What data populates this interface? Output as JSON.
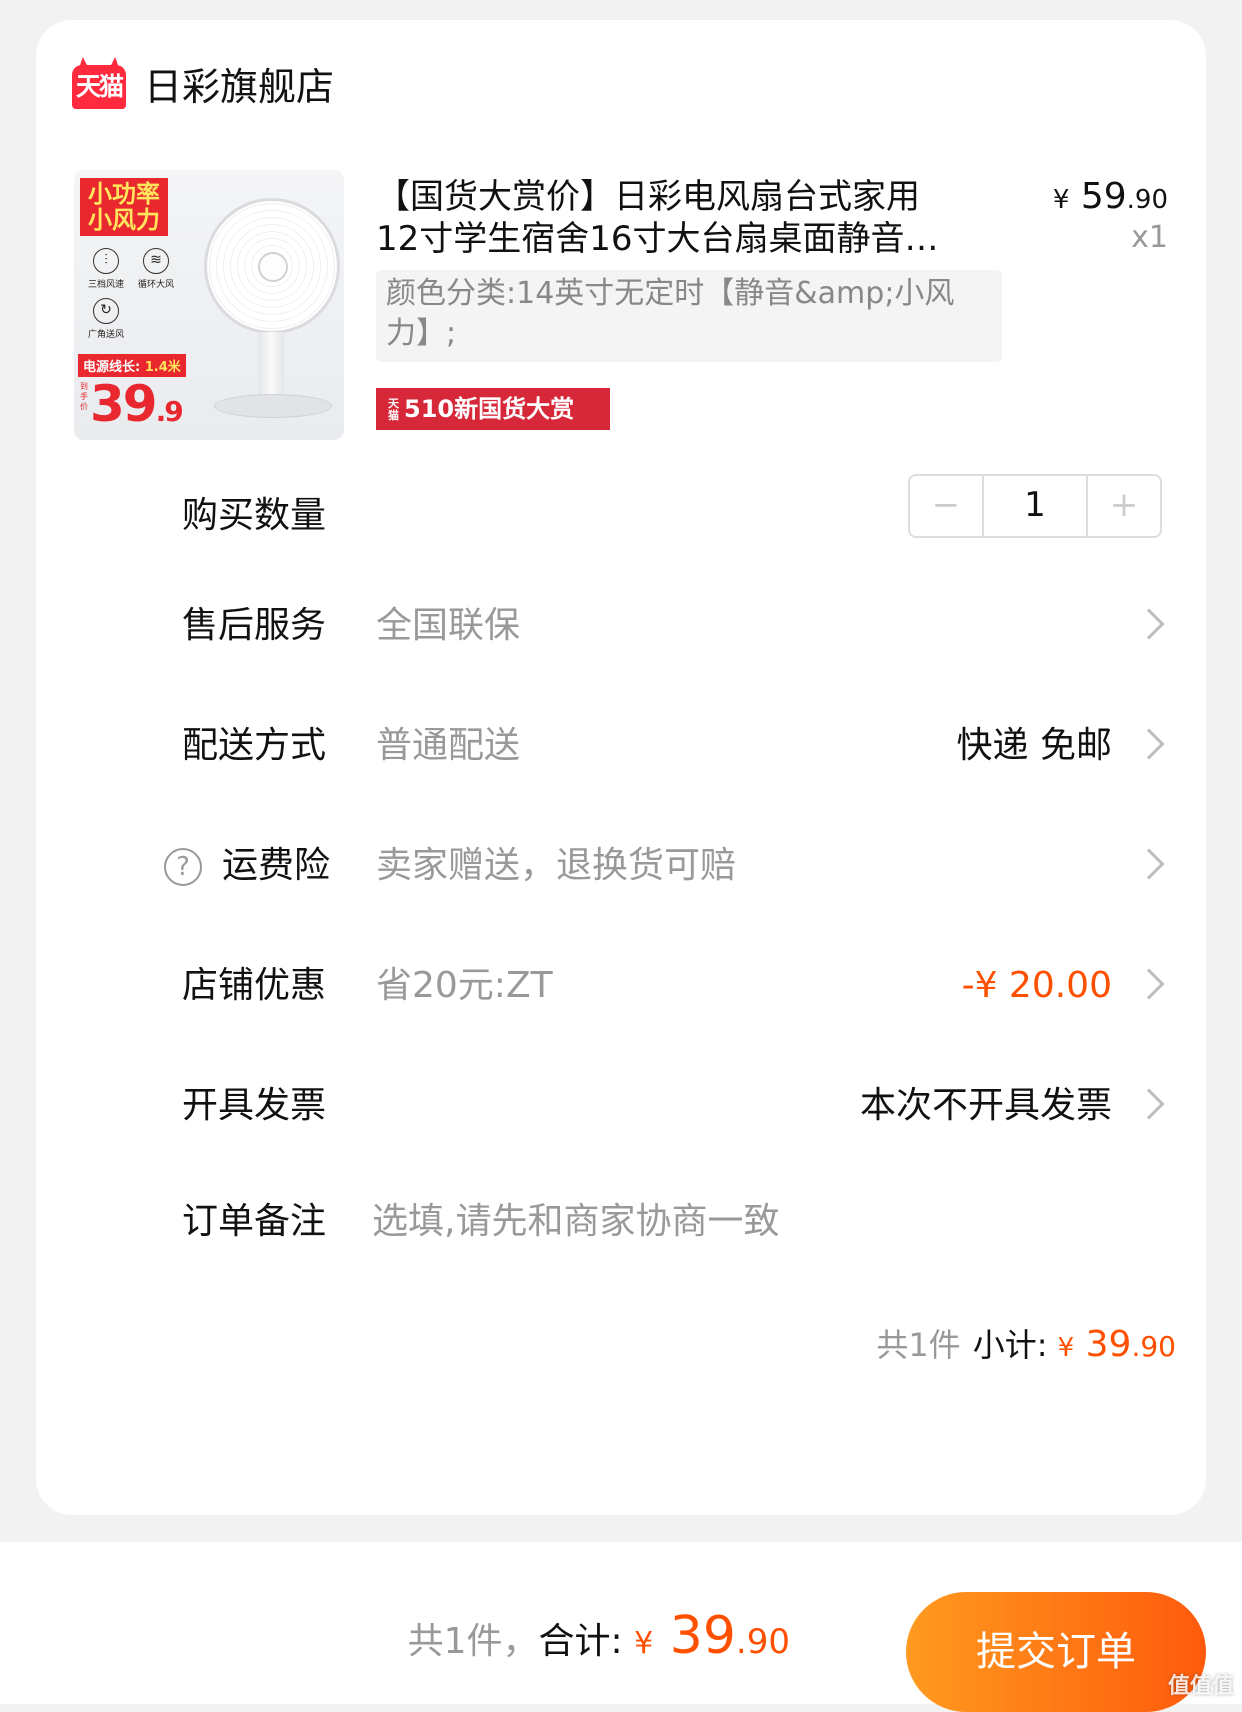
{
  "store": {
    "logo_text": "天猫",
    "name": "日彩旗舰店"
  },
  "product": {
    "thumb": {
      "tag1": "小功率小风力",
      "features": [
        "三档风速",
        "循环大风",
        "广角送风"
      ],
      "cord_label": "电源线长:",
      "cord_value": "1.4米",
      "price_label": "到手价",
      "price_int": "39",
      "price_dec": ".9"
    },
    "title_line1": "【国货大赏价】日彩电风扇台式家用",
    "title_line2": "12寸学生宿舍16寸大台扇桌面静音…",
    "price_currency": "¥",
    "price_int": "59",
    "price_dec": ".90",
    "quantity_label": "x1",
    "sku": "颜色分类:14英寸无定时【静音&amp;小风力】;",
    "promo_badge_small": "天猫",
    "promo_badge": "510新国货大赏"
  },
  "rows": {
    "quantity": {
      "label": "购买数量",
      "minus": "−",
      "value": "1",
      "plus": "+"
    },
    "after_sales": {
      "label": "售后服务",
      "value": "全国联保"
    },
    "delivery": {
      "label": "配送方式",
      "value": "普通配送",
      "right": "快递 免邮"
    },
    "shipping_insurance": {
      "label": "运费险",
      "value": "卖家赠送，退换货可赔",
      "help": "?"
    },
    "store_discount": {
      "label": "店铺优惠",
      "value": "省20元:ZT",
      "right": "-¥ 20.00"
    },
    "invoice": {
      "label": "开具发票",
      "right": "本次不开具发票"
    },
    "remark": {
      "label": "订单备注",
      "placeholder": "选填,请先和商家协商一致"
    }
  },
  "subtotal": {
    "count_text": "共1件",
    "label": "小计:",
    "currency": "¥",
    "int": " 39",
    "dec": ".90"
  },
  "footer": {
    "count_text": "共1件，",
    "label": "合计:",
    "currency": "¥",
    "int": " 39",
    "dec": ".90",
    "submit_label": "提交订单",
    "watermark": "值值值"
  },
  "colors": {
    "accent": "#ff5000",
    "tmall_red": "#ff2a3d",
    "button_start": "#ff9a1f",
    "button_end": "#ff5a0c"
  }
}
